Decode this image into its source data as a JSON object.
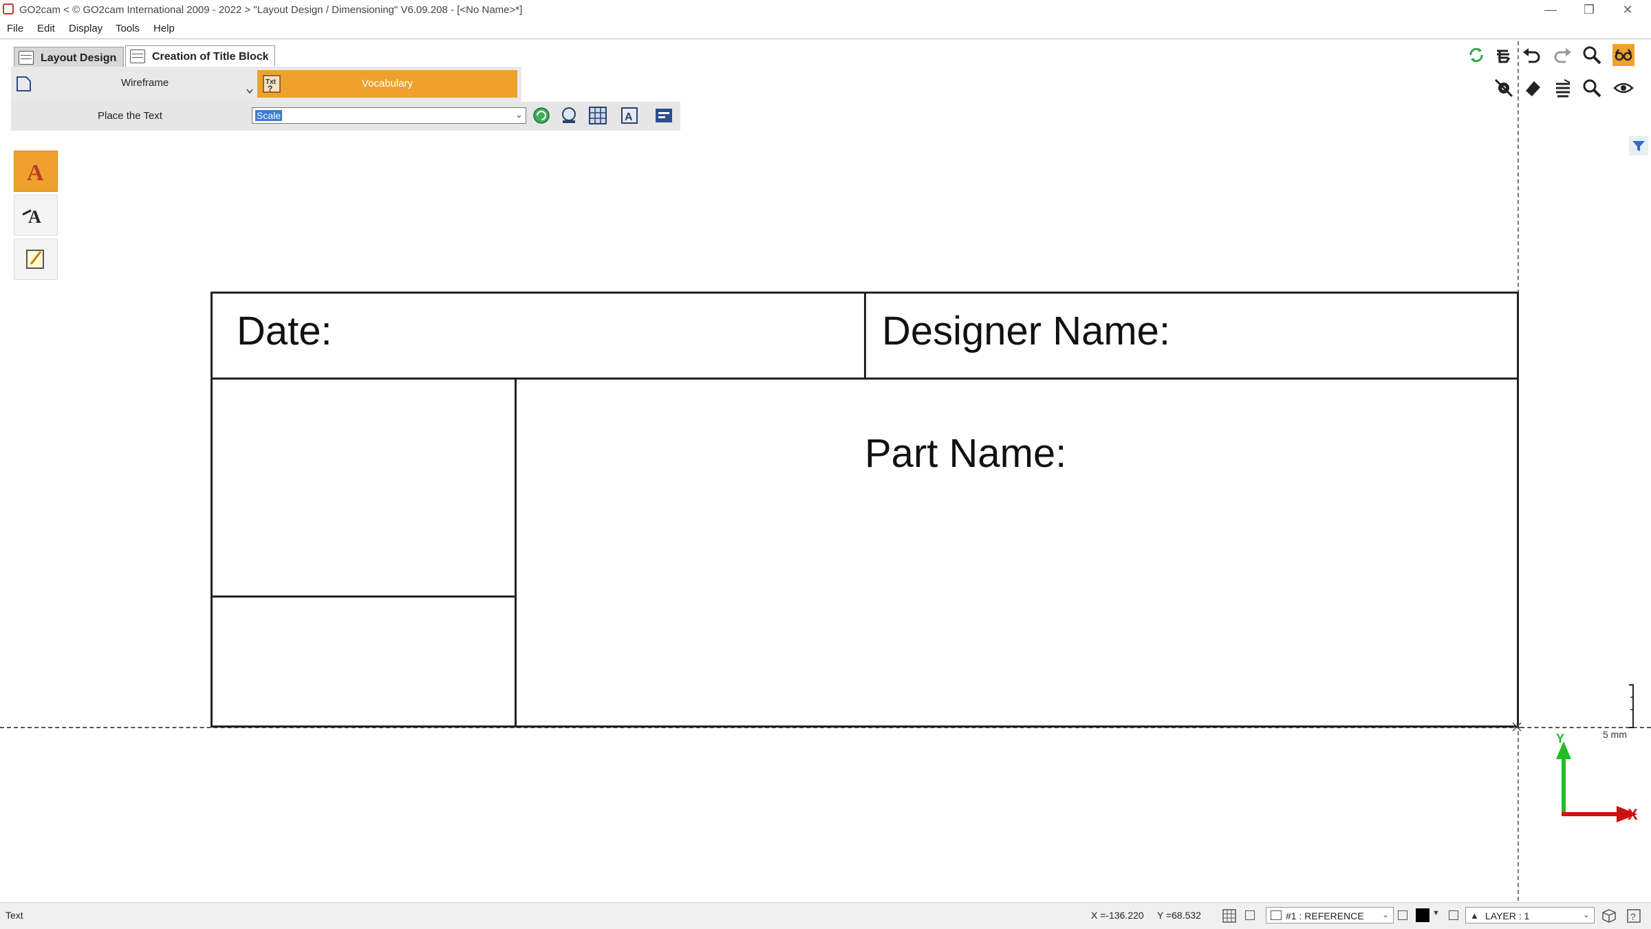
{
  "window": {
    "title": "GO2cam < © GO2cam International 2009 - 2022 >    \"Layout Design / Dimensioning\"   V6.09.208 - [<No Name>*]",
    "controls": [
      "—",
      "❐",
      "✕"
    ]
  },
  "menu": [
    "File",
    "Edit",
    "Display",
    "Tools",
    "Help"
  ],
  "tabs": [
    {
      "label": "Layout Design",
      "active": false
    },
    {
      "label": "Creation of Title Block",
      "active": true
    }
  ],
  "panel": {
    "wireframe_label": "Wireframe",
    "vocabulary_label": "Vocabulary",
    "place_text_label": "Place the Text",
    "combo_value": "Scale"
  },
  "drawing": {
    "date_label": "Date:",
    "designer_label": "Designer Name:",
    "part_label": "Part Name:",
    "scale_label": "5 mm",
    "axis_y": "Y",
    "axis_x": "X"
  },
  "status": {
    "mode": "Text",
    "x": "X =-136.220",
    "y": "Y =68.532",
    "reference": "#1 : REFERENCE",
    "layer": "LAYER : 1"
  },
  "colors": {
    "accent": "#eea22d",
    "axis_x": "#cc1111",
    "axis_y": "#22bb22"
  },
  "icons": {
    "top_right_row1": [
      "refresh-icon",
      "hand-pan-icon",
      "undo-icon",
      "redo-icon",
      "zoom-icon",
      "glasses-icon"
    ],
    "top_right_row2": [
      "gear-hide-icon",
      "eraser-icon",
      "layers-icon",
      "zoom-window-icon",
      "eye-icon"
    ],
    "palette": [
      "text-icon",
      "edit-text-icon",
      "note-icon"
    ]
  }
}
